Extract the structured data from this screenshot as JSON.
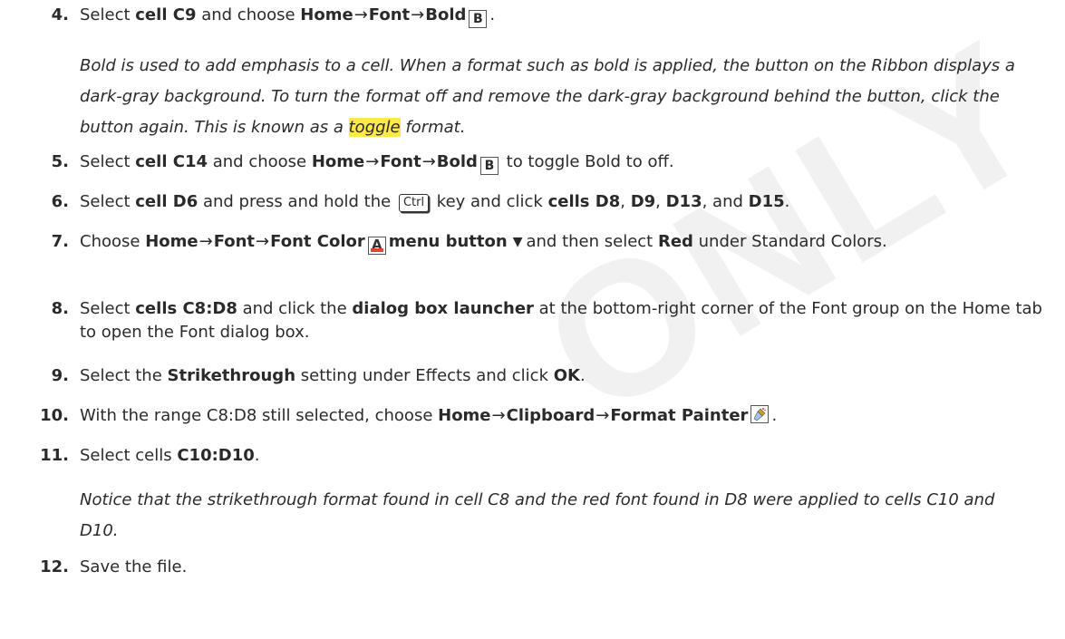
{
  "watermark": "ONLY",
  "icons": {
    "bold_glyph": "B",
    "font_color_glyph": "A",
    "dropdown_arrow": "▼",
    "arrow": "→",
    "font_color_bar": "#e2433a",
    "highlight": "#ffe84a"
  },
  "step4": {
    "num": "4.",
    "t1": "Select ",
    "b1": "cell C9",
    "t2": " and choose ",
    "b2": "Home",
    "b3": "Font",
    "b4": "Bold",
    "t3": "."
  },
  "note1": {
    "t1": "Bold is used to add emphasis to a cell. When a format such as bold is applied, the button on the Ribbon displays a dark-gray background. To turn the format off and remove the dark-gray background behind the button, click the button again. This is known as a ",
    "highlight": "toggle",
    "t2": " format."
  },
  "step5": {
    "num": "5.",
    "t1": "Select ",
    "b1": "cell C14",
    "t2": " and choose ",
    "b2": "Home",
    "b3": "Font",
    "b4": "Bold",
    "t3": " to toggle Bold to off."
  },
  "step6": {
    "num": "6.",
    "t1": "Select ",
    "b1": "cell D6",
    "t2": " and press and hold the ",
    "key": "Ctrl",
    "t3": " key and click ",
    "b2": "cells D8",
    "s1": ", ",
    "b3": "D9",
    "s2": ", ",
    "b4": "D13",
    "s3": ", and ",
    "b5": "D15",
    "t4": "."
  },
  "step7": {
    "num": "7.",
    "t1": "Choose ",
    "b1": "Home",
    "b2": "Font",
    "b3": "Font Color",
    "b4": "menu button",
    "t2": "and then select ",
    "b5": "Red",
    "t3": " under Standard Colors."
  },
  "step8": {
    "num": "8.",
    "t1": "Select ",
    "b1": "cells C8:D8",
    "t2": " and click the ",
    "b2": "dialog box launcher",
    "t3": " at the bottom-right corner of the Font group on the Home tab to open the Font dialog box."
  },
  "step9": {
    "num": "9.",
    "t1": "Select the ",
    "b1": "Strikethrough",
    "t2": " setting under Effects and click ",
    "b2": "OK",
    "t3": "."
  },
  "step10": {
    "num": "10.",
    "t1": "With the range C8:D8 still selected, choose ",
    "b1": "Home",
    "b2": "Clipboard",
    "b3": "Format Painter",
    "t2": "."
  },
  "step11": {
    "num": "11.",
    "t1": "Select cells ",
    "b1": "C10:D10",
    "t2": "."
  },
  "note2": {
    "text": "Notice that the strikethrough format found in cell C8 and the red font found in D8 were applied to cells C10 and D10."
  },
  "step12": {
    "num": "12.",
    "text": "Save the file."
  }
}
